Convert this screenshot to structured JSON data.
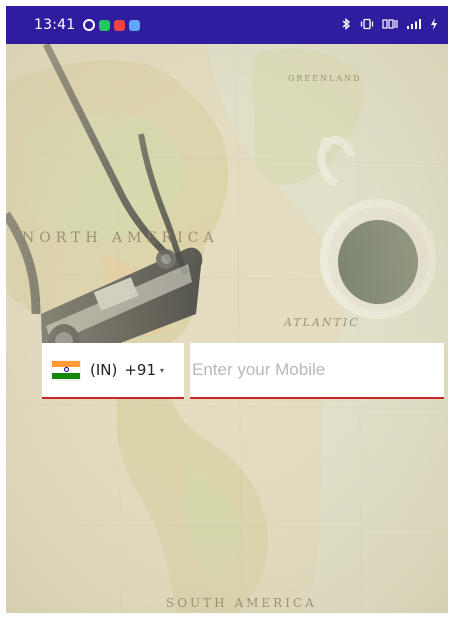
{
  "status_bar": {
    "time": "13:41",
    "background_color": "#2e1d9e",
    "left_icons": [
      {
        "name": "sync-ring-icon",
        "color": "#ffffff"
      },
      {
        "name": "app-green-icon",
        "color": "#22c55e"
      },
      {
        "name": "app-red-icon",
        "color": "#ef4444"
      },
      {
        "name": "app-blue-icon",
        "color": "#60a5fa"
      }
    ],
    "right_text": "✶ ▦ Ⅱ ∥ll",
    "right_icons": [
      "bluetooth-icon",
      "vibrate-icon",
      "volte-icon",
      "signal-icon",
      "charging-icon"
    ]
  },
  "background": {
    "map_labels": {
      "greenland": "GREENLAND",
      "north_america": "NORTH AMERICA",
      "atlantic": "ATLANTIC",
      "south_america": "SOUTH AMERICA"
    },
    "base_color": "#e6e0c6"
  },
  "phone_entry": {
    "country": {
      "flag": "india-flag-icon",
      "iso": "(IN)",
      "dial_code": "+91",
      "arrow": "▾"
    },
    "mobile": {
      "value": "",
      "placeholder": "Enter your Mobile"
    },
    "underline_color": "#c62828"
  }
}
